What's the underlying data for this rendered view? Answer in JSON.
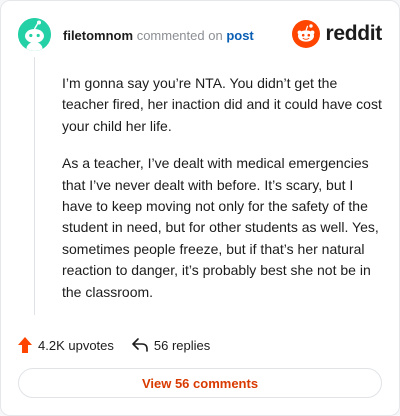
{
  "header": {
    "username": "filetomnom",
    "action_text": "commented on",
    "post_link": "post",
    "brand": "reddit",
    "avatar_icon": "snoo-avatar-icon",
    "brand_color": "#ff4500"
  },
  "comment": {
    "paragraphs": [
      "I’m gonna say you’re NTA. You didn’t get the teacher fired, her inaction did and it could have cost your child her life.",
      "As a teacher, I’ve dealt with medical emergencies that I’ve never dealt with before. It’s scary, but I have to keep moving not only for the safety of the student in need, but for other students as well. Yes, sometimes people freeze, but if that’s her natural reaction to danger, it’s probably best she not be in the classroom."
    ]
  },
  "actions": {
    "upvotes": "4.2K upvotes",
    "replies": "56 replies",
    "upvote_icon": "upvote-arrow-icon",
    "reply_icon": "reply-arrow-icon",
    "upvote_color": "#ff4500"
  },
  "footer": {
    "view_comments": "View 56 comments",
    "accent": "#d93a00"
  }
}
